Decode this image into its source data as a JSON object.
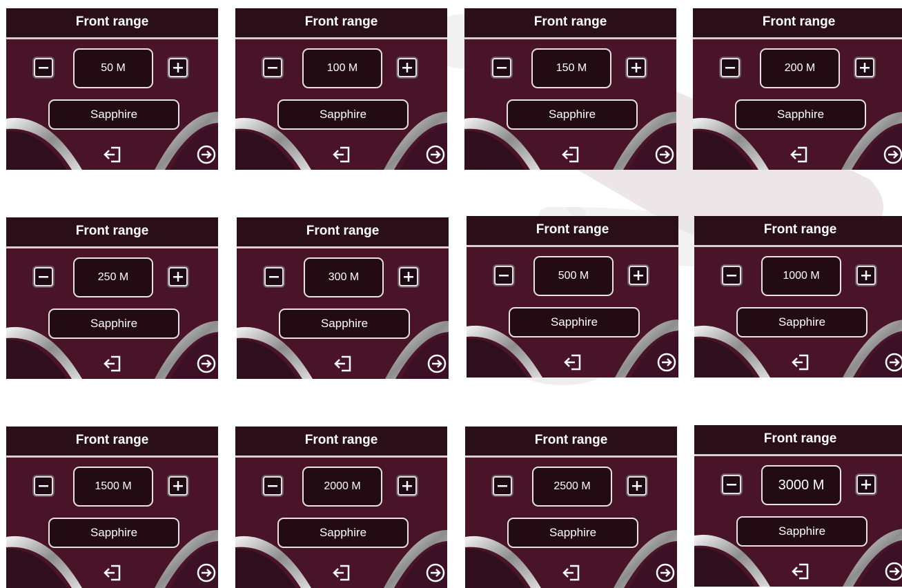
{
  "panels": [
    {
      "title": "Front range",
      "value": "50 M",
      "mode": "Sapphire"
    },
    {
      "title": "Front range",
      "value": "100 M",
      "mode": "Sapphire"
    },
    {
      "title": "Front range",
      "value": "150 M",
      "mode": "Sapphire"
    },
    {
      "title": "Front range",
      "value": "200 M",
      "mode": "Sapphire"
    },
    {
      "title": "Front range",
      "value": "250 M",
      "mode": "Sapphire"
    },
    {
      "title": "Front range",
      "value": "300 M",
      "mode": "Sapphire"
    },
    {
      "title": "Front range",
      "value": "500 M",
      "mode": "Sapphire"
    },
    {
      "title": "Front range",
      "value": "1000 M",
      "mode": "Sapphire"
    },
    {
      "title": "Front range",
      "value": "1500 M",
      "mode": "Sapphire"
    },
    {
      "title": "Front range",
      "value": "2000 M",
      "mode": "Sapphire"
    },
    {
      "title": "Front range",
      "value": "2500 M",
      "mode": "Sapphire"
    },
    {
      "title": "Front range",
      "value": "3000 M",
      "mode": "Sapphire"
    }
  ],
  "icons": {
    "decrease": "minus-icon",
    "increase": "plus-icon",
    "back": "exit-icon",
    "next": "arrow-right-circle-icon"
  },
  "colors": {
    "panel_bg": "#4a1428",
    "header_bg": "#2a0f18",
    "text": "#ffffff",
    "border": "#e9e2e5"
  }
}
